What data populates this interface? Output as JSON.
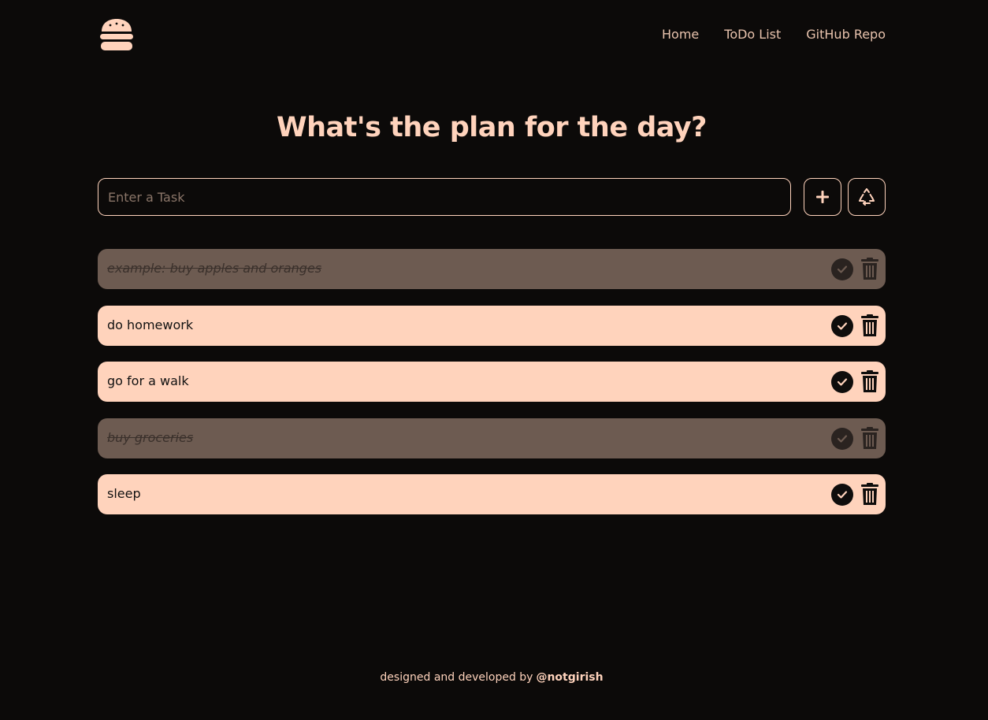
{
  "nav": {
    "logo": "burger-icon",
    "links": [
      "Home",
      "ToDo List",
      "GitHub Repo"
    ]
  },
  "heading": "What's the plan for the day?",
  "input": {
    "placeholder": "Enter a Task",
    "value": ""
  },
  "buttons": {
    "add_icon": "plus-icon",
    "reset_icon": "recycle-icon"
  },
  "tasks": [
    {
      "text": "example: buy apples and oranges",
      "completed": true
    },
    {
      "text": "do homework",
      "completed": false
    },
    {
      "text": "go for a walk",
      "completed": false
    },
    {
      "text": "buy groceries",
      "completed": true
    },
    {
      "text": "sleep",
      "completed": false
    }
  ],
  "task_icons": {
    "complete": "check-circle-icon",
    "delete": "trash-icon"
  },
  "footer": {
    "text": "designed and developed by",
    "handle": "@notgirish"
  },
  "colors": {
    "background": "#0c0a09",
    "accent": "#ffd3bc",
    "completed_row": "#6d5b51"
  }
}
